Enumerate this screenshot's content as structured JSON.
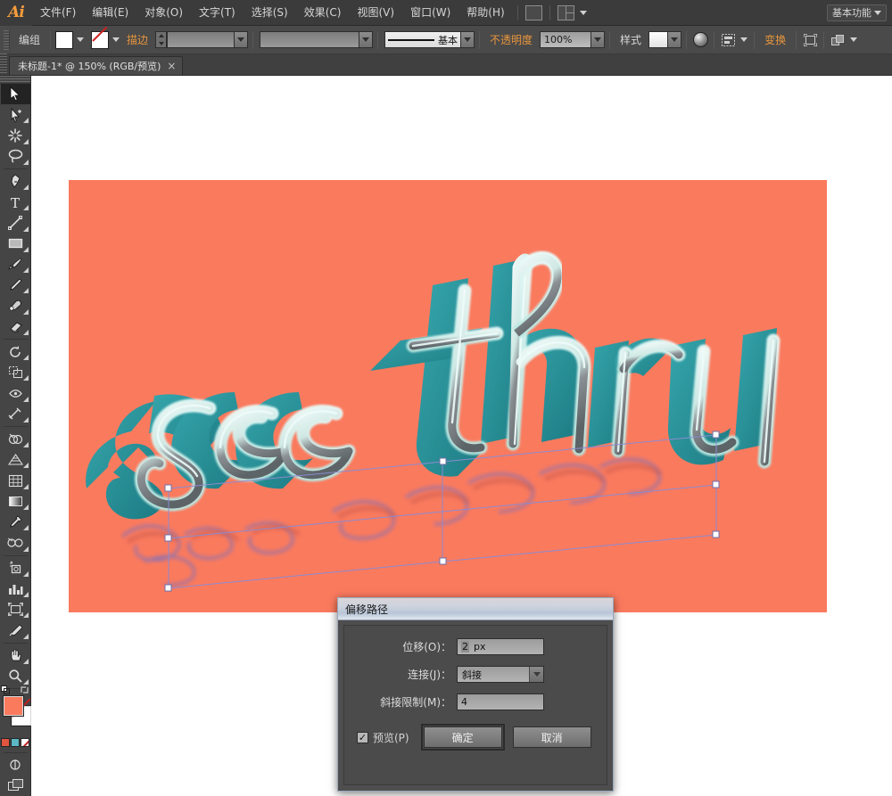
{
  "app": {
    "name": "Ai",
    "workspace": "基本功能"
  },
  "menubar": {
    "items": [
      {
        "label": "文件(F)"
      },
      {
        "label": "编辑(E)"
      },
      {
        "label": "对象(O)"
      },
      {
        "label": "文字(T)"
      },
      {
        "label": "选择(S)"
      },
      {
        "label": "效果(C)"
      },
      {
        "label": "视图(V)"
      },
      {
        "label": "窗口(W)"
      },
      {
        "label": "帮助(H)"
      }
    ],
    "bridge_icon": "bridge-icon",
    "arrange_icon": "arrange-documents-icon"
  },
  "controlbar": {
    "selection_label": "编组",
    "fill_color": "#fa7a5e",
    "stroke_color": "none",
    "stroke_label": "描边",
    "stroke_weight": "",
    "stroke_profile_label": "基本",
    "opacity_label": "不透明度",
    "opacity_value": "100%",
    "style_label": "样式",
    "transform_label": "变换",
    "icons": {
      "opacity_sphere": "transparency-sphere-icon",
      "align": "align-icon",
      "isolate": "isolate-group-icon",
      "arrange": "arrange-objects-icon"
    }
  },
  "tabbar": {
    "document_title": "未标题-1* @ 150% (RGB/预览)",
    "close_glyph": "×"
  },
  "toolpanel": {
    "tools": [
      {
        "name": "selection-tool",
        "active": true
      },
      {
        "name": "direct-selection-tool",
        "active": false
      },
      {
        "name": "magic-wand-tool",
        "active": false
      },
      {
        "name": "lasso-tool",
        "active": false
      },
      {
        "name": "pen-tool",
        "active": false
      },
      {
        "name": "type-tool",
        "active": false
      },
      {
        "name": "line-segment-tool",
        "active": false
      },
      {
        "name": "rectangle-tool",
        "active": false
      },
      {
        "name": "paintbrush-tool",
        "active": false
      },
      {
        "name": "pencil-tool",
        "active": false
      },
      {
        "name": "blob-brush-tool",
        "active": false
      },
      {
        "name": "eraser-tool",
        "active": false
      },
      {
        "name": "rotate-tool",
        "active": false
      },
      {
        "name": "scale-tool",
        "active": false
      },
      {
        "name": "width-tool",
        "active": false
      },
      {
        "name": "free-transform-tool",
        "active": false
      },
      {
        "name": "shape-builder-tool",
        "active": false
      },
      {
        "name": "perspective-grid-tool",
        "active": false
      },
      {
        "name": "mesh-tool",
        "active": false
      },
      {
        "name": "gradient-tool",
        "active": false
      },
      {
        "name": "eyedropper-tool",
        "active": false
      },
      {
        "name": "blend-tool",
        "active": false
      },
      {
        "name": "symbol-sprayer-tool",
        "active": false
      },
      {
        "name": "column-graph-tool",
        "active": false
      },
      {
        "name": "artboard-tool",
        "active": false
      },
      {
        "name": "slice-tool",
        "active": false
      },
      {
        "name": "hand-tool",
        "active": false
      },
      {
        "name": "zoom-tool",
        "active": false
      }
    ],
    "fill_color": "#fa7a5e",
    "stroke_color": "none",
    "color_modes": [
      {
        "name": "color-mode",
        "color": "#e0553f"
      },
      {
        "name": "gradient-mode",
        "color": "#5cb8c4"
      },
      {
        "name": "none-mode",
        "color": "#ffffff"
      }
    ]
  },
  "artwork": {
    "text": "see thru",
    "artboard_bg": "#fa7a5e",
    "extrude_color": "#1f8f96",
    "face_color": "#2ea3ab",
    "highlight_color": "#d8f3f0",
    "selection_color": "#6a7bd8",
    "path_color": "#8e7fd0"
  },
  "dialog": {
    "title": "偏移路径",
    "fields": [
      {
        "label": "位移(O)：",
        "value": "2",
        "unit": "px",
        "type": "input"
      },
      {
        "label": "连接(J)：",
        "value": "斜接",
        "type": "select"
      },
      {
        "label": "斜接限制(M)：",
        "value": "4",
        "type": "input"
      }
    ],
    "preview_label": "预览(P)",
    "preview_checked": true,
    "check_glyph": "✓",
    "ok_label": "确定",
    "cancel_label": "取消"
  }
}
